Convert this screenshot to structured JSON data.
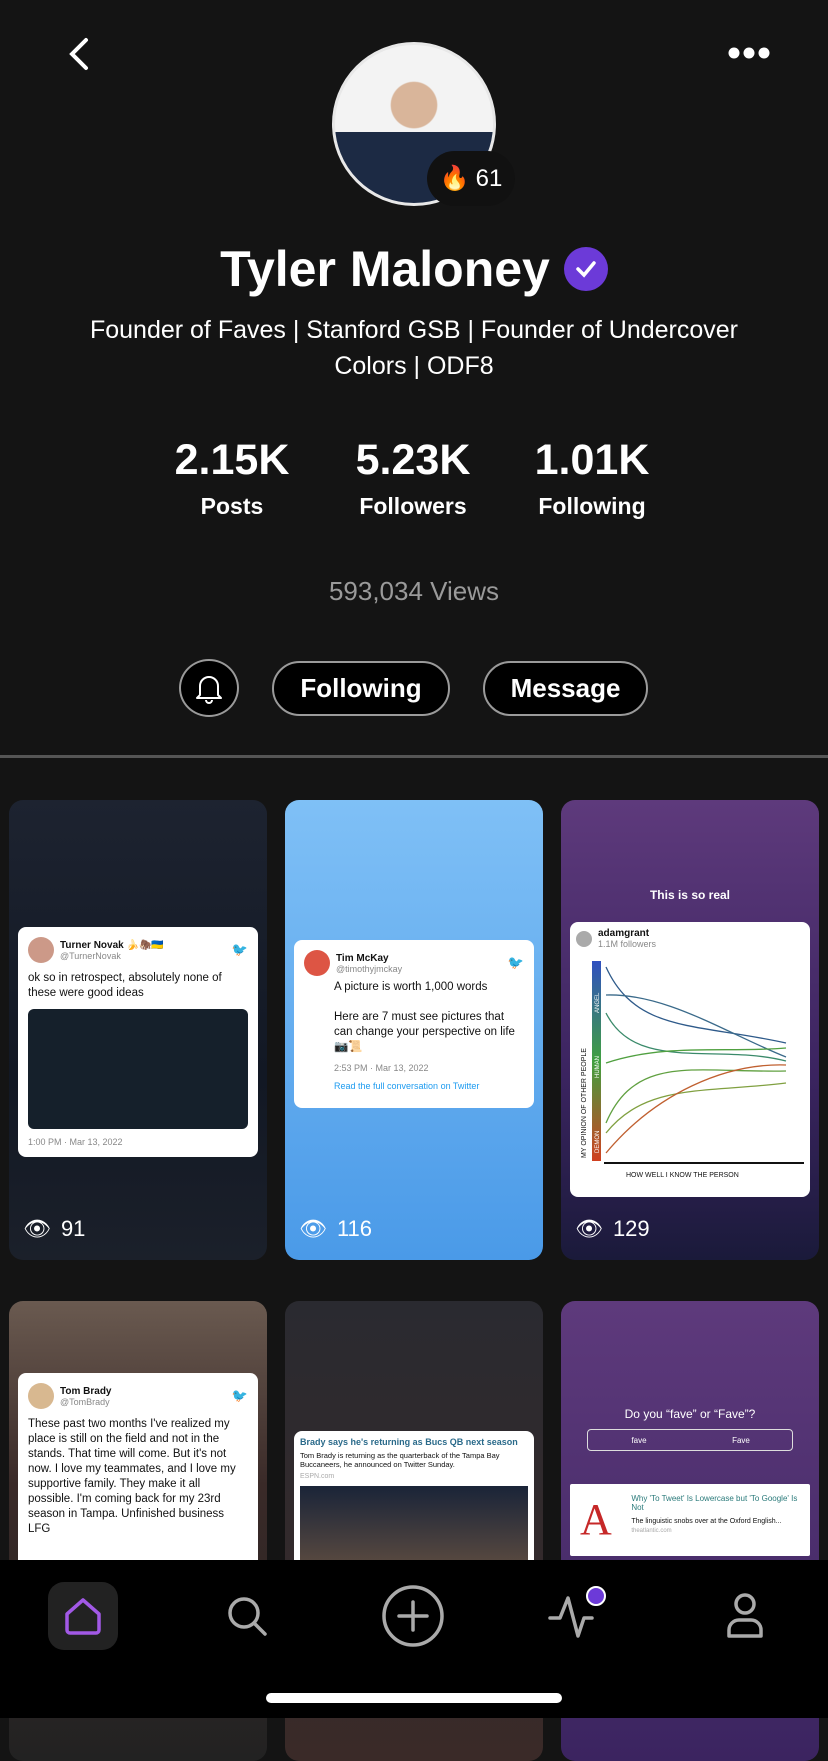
{
  "header": {
    "back_icon": "chevron-left-icon",
    "more_icon": "more-dots-icon"
  },
  "profile": {
    "name": "Tyler Maloney",
    "fire_emoji": "🔥",
    "streak": "61",
    "bio": "Founder of Faves | Stanford GSB | Founder of Undercover Colors | ODF8",
    "verified_color": "#6c3ad8"
  },
  "stats": [
    {
      "value": "2.15K",
      "label": "Posts"
    },
    {
      "value": "5.23K",
      "label": "Followers"
    },
    {
      "value": "1.01K",
      "label": "Following"
    }
  ],
  "views": "593,034 Views",
  "actions": {
    "following": "Following",
    "message": "Message"
  },
  "posts": [
    {
      "views": "91",
      "tweet": {
        "name": "Turner Novak 🍌🦣🇺🇦",
        "handle": "@TurnerNovak",
        "text": "ok so in retrospect, absolutely none of these were good ideas",
        "time": "1:00 PM · Mar 13, 2022"
      }
    },
    {
      "views": "116",
      "tweet": {
        "name": "Tim McKay",
        "handle": "@timothyjmckay",
        "text": "A picture is worth 1,000 words\n\nHere are 7 must see pictures that can change your perspective on life 📷📜",
        "time": "2:53 PM · Mar 13, 2022",
        "link": "Read the full conversation on Twitter"
      }
    },
    {
      "views": "129",
      "caption": "This is so real",
      "tweet": {
        "name": "adamgrant",
        "handle": "1.1M followers",
        "yaxis": "MY OPINION OF OTHER PEOPLE",
        "xaxis": "HOW WELL I KNOW THE PERSON",
        "levels": [
          "ANGEL",
          "HUMAN",
          "DEMON"
        ]
      }
    },
    {
      "tweet": {
        "name": "Tom Brady",
        "handle": "@TomBrady",
        "text": "These past two months I've realized my place is still on the field and not in the stands. That time will come. But it's not now. I love my teammates, and I love my supportive family. They make it all possible. I'm coming back for my 23rd season in Tampa. Unfinished business LFG"
      }
    },
    {
      "article": {
        "title": "Brady says he's returning as Bucs QB next season",
        "text": "Tom Brady is returning as the quarterback of the Tampa Bay Buccaneers, he announced on Twitter Sunday.",
        "source": "ESPN.com"
      }
    },
    {
      "caption": "Do you “fave” or “Fave”?",
      "options": [
        "fave",
        "Fave"
      ],
      "article": {
        "logo": "A",
        "title": "Why 'To Tweet' Is Lowercase but 'To Google' Is Not",
        "text": "The linguistic snobs over at the Oxford English...",
        "source": "theatlantic.com"
      }
    }
  ],
  "tabs": [
    {
      "name": "home",
      "active": true
    },
    {
      "name": "search"
    },
    {
      "name": "create"
    },
    {
      "name": "activity",
      "badge": true
    },
    {
      "name": "profile"
    }
  ],
  "accent": "#a259e6"
}
